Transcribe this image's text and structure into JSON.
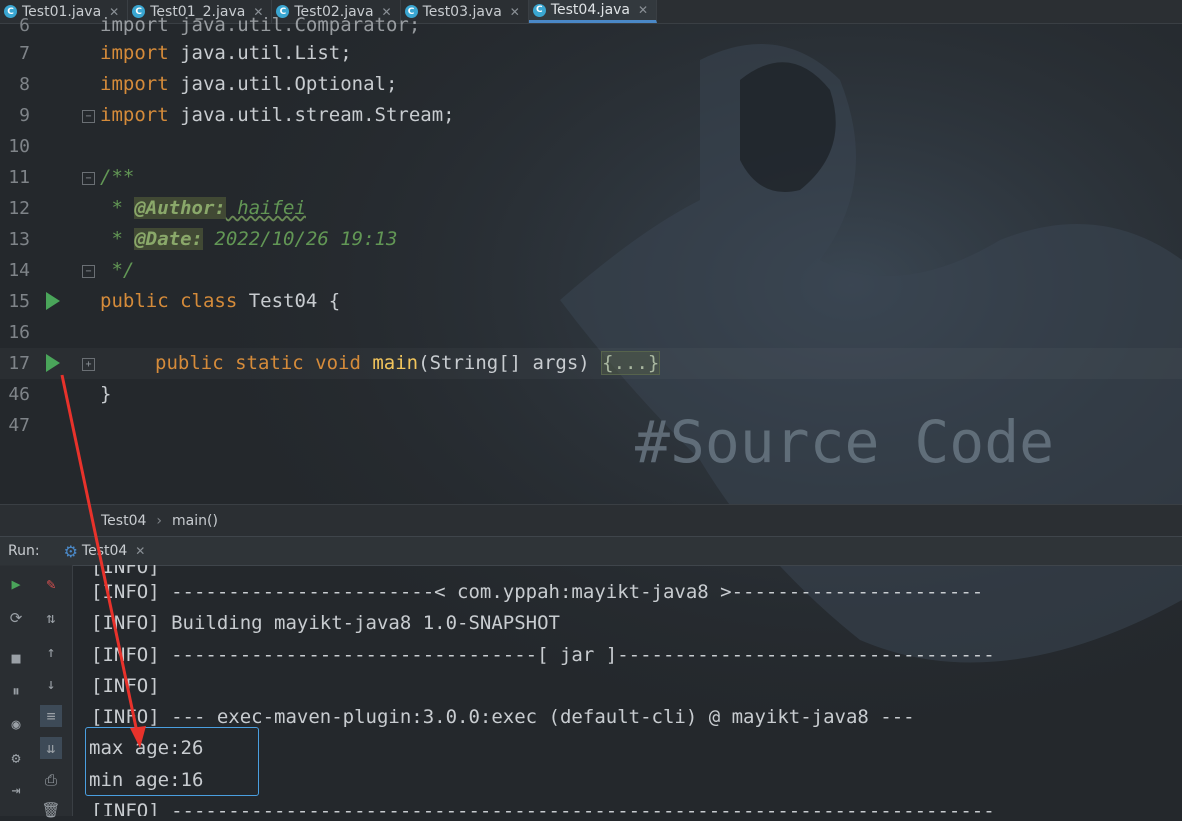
{
  "tabs": [
    {
      "label": "Test01.java",
      "active": false
    },
    {
      "label": "Test01_2.java",
      "active": false
    },
    {
      "label": "Test02.java",
      "active": false
    },
    {
      "label": "Test03.java",
      "active": false
    },
    {
      "label": "Test04.java",
      "active": true
    }
  ],
  "editor": {
    "lines": [
      {
        "num": "6",
        "text": "import java.util.Comparator;"
      },
      {
        "num": "7",
        "kw": "import",
        "rest": " java.util.List;"
      },
      {
        "num": "8",
        "kw": "import",
        "rest": " java.util.Optional;"
      },
      {
        "num": "9",
        "kw": "import",
        "rest": " java.util.stream.Stream;"
      },
      {
        "num": "10"
      },
      {
        "num": "11",
        "comment": "/**"
      },
      {
        "num": "12",
        "prefix": " * ",
        "tag": "@Author:",
        "value": " haifei"
      },
      {
        "num": "13",
        "prefix": " * ",
        "tag": "@Date:",
        "value": " 2022/10/26 19:13"
      },
      {
        "num": "14",
        "comment": " */"
      },
      {
        "num": "15",
        "kw": "public class",
        "rest": " Test04 {"
      },
      {
        "num": "16"
      },
      {
        "num": "17",
        "kw": "public static void",
        "fn": "main",
        "args": "(String[] args) ",
        "fold": "{...}"
      },
      {
        "num": "46",
        "rest": "}"
      },
      {
        "num": "47"
      }
    ]
  },
  "breadcrumb": {
    "class": "Test04",
    "sep": "›",
    "method": "main()"
  },
  "run": {
    "label": "Run:",
    "tab": "Test04"
  },
  "console": {
    "lines": [
      "[INFO]",
      "[INFO] -----------------------< com.yppah:mayikt-java8 >----------------------",
      "[INFO] Building mayikt-java8 1.0-SNAPSHOT",
      "[INFO] --------------------------------[ jar ]---------------------------------",
      "[INFO]",
      "[INFO] --- exec-maven-plugin:3.0.0:exec (default-cli) @ mayikt-java8 ---",
      "max age:26",
      "min age:16",
      "[INFO] ------------------------------------------------------------------------"
    ]
  },
  "background_text": "#Source Code",
  "colors": {
    "keyword": "#d58b3a",
    "comment": "#629755",
    "accent": "#4a88c7",
    "arrow": "#e8322b"
  }
}
